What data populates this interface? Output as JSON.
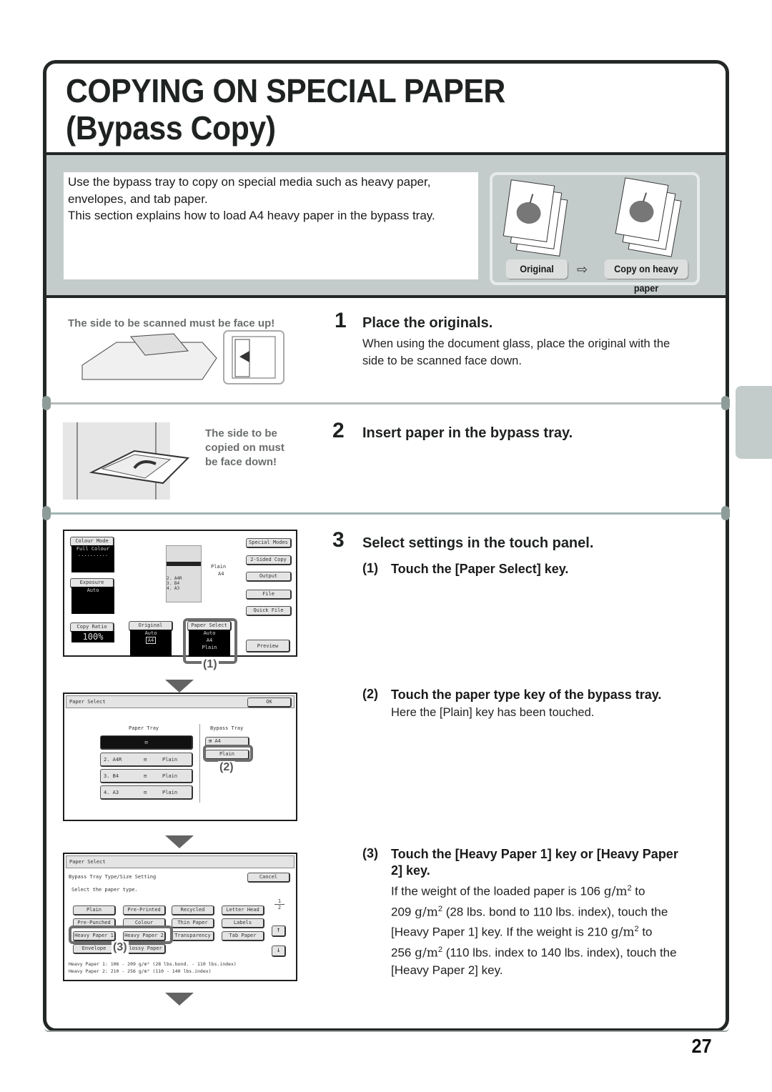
{
  "header": {
    "title_line1": "COPYING ON SPECIAL PAPER",
    "title_line2": "(Bypass Copy)"
  },
  "intro": {
    "line1": "Use the bypass tray to copy on special media such as heavy paper,",
    "line2": "envelopes, and tab paper.",
    "line3": "This section explains how to load A4 heavy paper in the bypass tray."
  },
  "illustration": {
    "original_label": "Original",
    "copy_label": "Copy on heavy paper"
  },
  "step1": {
    "number": "1",
    "title": "Place the originals.",
    "body_line1": "When using the document glass, place the original with the",
    "body_line2": "side to be scanned face down.",
    "note": "The side to be scanned must be face up!"
  },
  "step2": {
    "number": "2",
    "title": "Insert paper in the bypass tray.",
    "note_line1": "The side to be",
    "note_line2": "copied on must",
    "note_line3": "be face down!"
  },
  "step3": {
    "number": "3",
    "title": "Select settings in the touch panel.",
    "sub1": {
      "num": "(1)",
      "title": "Touch the [Paper Select] key."
    },
    "sub2": {
      "num": "(2)",
      "title": "Touch the paper type key of the bypass tray.",
      "body": "Here the [Plain] key has been touched."
    },
    "sub3": {
      "num": "(3)",
      "title_line1": "Touch the [Heavy Paper 1] key or [Heavy Paper",
      "title_line2": "2] key.",
      "body": [
        "If the weight of the loaded paper is 106 ",
        "209 ",
        "(28 lbs. bond to 110 lbs. index), touch the",
        "[Heavy Paper 1] key. If the weight is 210 ",
        "256 ",
        "(110 lbs. index to 140 lbs. index), touch the",
        "[Heavy Paper 2] key."
      ],
      "unit": "g/m",
      "unit_exp": "2",
      "to": " to"
    }
  },
  "screen1": {
    "colour_mode": "Colour Mode",
    "colour_value": "Full Colour",
    "exposure": "Exposure",
    "exposure_value": "Auto",
    "copy_ratio": "Copy Ratio",
    "copy_ratio_value": "100%",
    "original": "Original",
    "original_value": "Auto",
    "original_size": "A4",
    "paper_select": "Paper Select",
    "paper_select_values": [
      "Auto",
      "A4",
      "Plain"
    ],
    "special_modes": "Special Modes",
    "two_sided": "2-Sided Copy",
    "output": "Output",
    "file": "File",
    "quick_file": "Quick File",
    "preview": "Preview",
    "bypass_type": "Plain",
    "bypass_size": "A4",
    "trays": [
      "2.  A4R",
      "3.  B4",
      "4.  A3"
    ],
    "callout": "(1)"
  },
  "screen2": {
    "title": "Paper Select",
    "ok": "OK",
    "paper_tray": "Paper Tray",
    "bypass_tray": "Bypass Tray",
    "trays": [
      {
        "name": "",
        "type": ""
      },
      {
        "name": "2. A4R",
        "type": "Plain"
      },
      {
        "name": "3. B4",
        "type": "Plain"
      },
      {
        "name": "4. A3",
        "type": "Plain"
      }
    ],
    "bypass_size": "A4",
    "bypass_type": "Plain",
    "callout": "(2)"
  },
  "screen3": {
    "title": "Paper Select",
    "subtitle": "Bypass Tray Type/Size Setting",
    "cancel": "Cancel",
    "prompt": "Select the paper type.",
    "buttons": [
      [
        "Plain",
        "Pre-Printed",
        "Recycled",
        "Letter Head"
      ],
      [
        "Pre-Punched",
        "Colour",
        "Thin Paper",
        "Labels"
      ],
      [
        "Heavy Paper 1",
        "Heavy Paper 2",
        "Transparency",
        "Tab Paper"
      ],
      [
        "Envelope",
        "Glossy Paper"
      ]
    ],
    "page_current": "1",
    "page_total": "2",
    "info1": "Heavy Paper 1: 106 - 209 g/m² (28 lbs.bond. - 110 lbs.index)",
    "info2": "Heavy Paper 2: 210 - 256 g/m² (110 - 140 lbs.index)",
    "callout": "(3)"
  },
  "footer": {
    "page_number": "27"
  }
}
